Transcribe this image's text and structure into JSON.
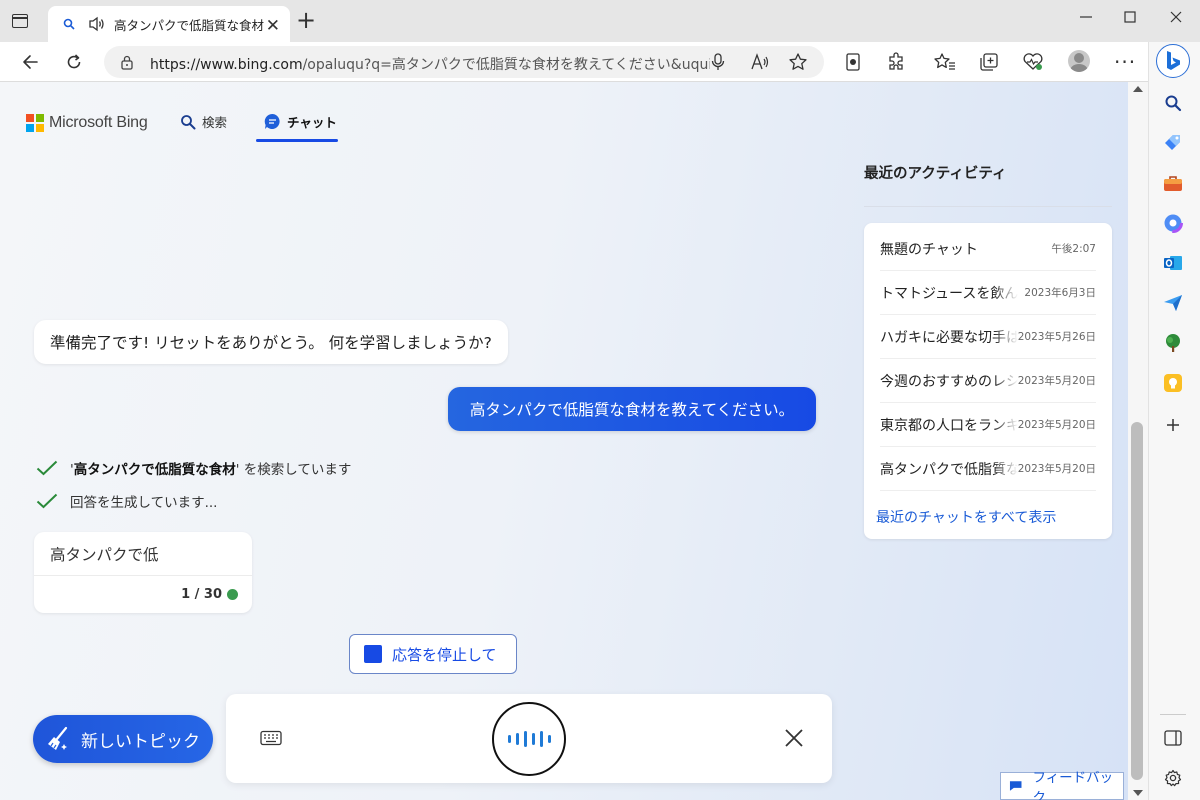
{
  "browser": {
    "tab_title": "高タンパクで低脂質な食材を教",
    "new_tab": "+",
    "address": {
      "url_prefix": "https://www.bing.com",
      "url_rest": "/opaluqu?q=高タンパクで低脂質な食材を教えてください&uquinputty..."
    },
    "window_controls": {
      "minimize": "—",
      "maximize": "☐",
      "close": "✕"
    },
    "more_label": "···"
  },
  "bing": {
    "logo_text": "Microsoft Bing",
    "tabs": [
      {
        "label": "検索"
      },
      {
        "label": "チャット"
      }
    ]
  },
  "chat": {
    "bot_message": "準備完了です! リセットをありがとう。 何を学習しましょうか?",
    "user_message": "高タンパクで低脂質な食材を教えてください。",
    "steps": [
      {
        "quote_open": "'",
        "bold": "高タンパクで低脂質な食材",
        "quote_close": "'",
        "rest": " を検索しています"
      },
      {
        "text": "回答を生成しています..."
      }
    ],
    "partial_response": "高タンパクで低",
    "count": "1 / 30",
    "stop_label": "応答を停止して",
    "new_topic_label": "新しいトピック"
  },
  "recent": {
    "title": "最近のアクティビティ",
    "items": [
      {
        "title": "無題のチャット",
        "date": "午後2:07"
      },
      {
        "title": "トマトジュースを飲んだ",
        "date": "2023年6月3日"
      },
      {
        "title": "ハガキに必要な切手は",
        "date": "2023年5月26日"
      },
      {
        "title": "今週のおすすめのレシピ",
        "date": "2023年5月20日"
      },
      {
        "title": "東京都の人口をランキング",
        "date": "2023年5月20日"
      },
      {
        "title": "高タンパクで低脂質な",
        "date": "2023年5月20日"
      }
    ],
    "show_all": "最近のチャットをすべて表示"
  },
  "feedback_label": "フィードバック",
  "colors": {
    "accent": "#174ae4",
    "status_dot": "#3a9b4f",
    "check": "#2a8a3a"
  },
  "icons": {
    "tab_bar": [
      "tab-actions-icon",
      "search-favicon",
      "speaker-icon",
      "close-icon",
      "plus-icon"
    ],
    "toolbar": [
      "back-icon",
      "refresh-icon",
      "lock-icon",
      "mic-icon",
      "read-aloud-icon",
      "favorite-star-icon",
      "ebook-icon",
      "extensions-icon",
      "favorites-icon",
      "collections-icon",
      "browser-essentials-icon",
      "profile-icon",
      "more-icon",
      "bing-icon"
    ],
    "sidebar": [
      "search-icon",
      "tag-icon",
      "briefcase-icon",
      "office-icon",
      "outlook-icon",
      "send-icon",
      "tree-icon",
      "lightbulb-icon",
      "add-icon",
      "sidebar-toggle-icon",
      "settings-icon"
    ]
  }
}
